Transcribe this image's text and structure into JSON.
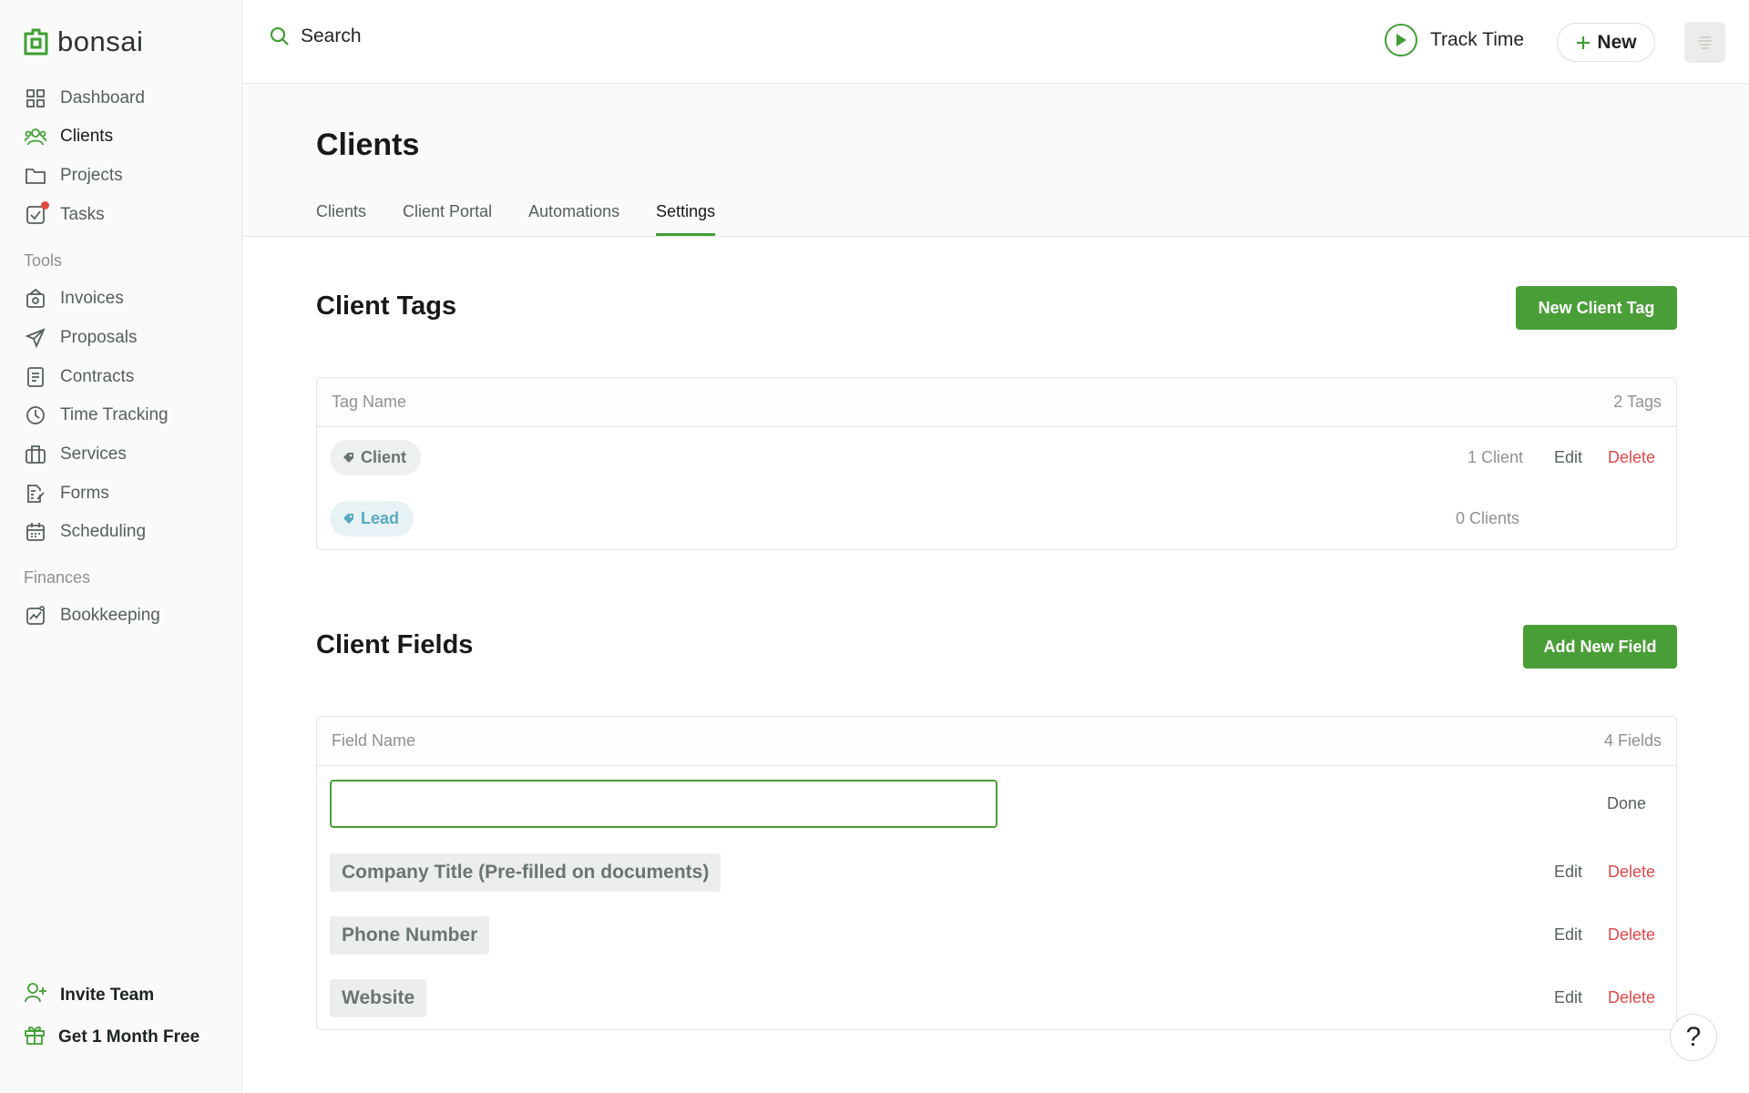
{
  "app": {
    "brand": "bonsai"
  },
  "sidebar": {
    "main_items": [
      {
        "label": "Dashboard",
        "icon": "grid-icon"
      },
      {
        "label": "Clients",
        "icon": "users-icon",
        "active": true
      },
      {
        "label": "Projects",
        "icon": "folder-icon"
      },
      {
        "label": "Tasks",
        "icon": "task-icon",
        "notification": true
      }
    ],
    "tools_heading": "Tools",
    "tools_items": [
      {
        "label": "Invoices",
        "icon": "invoice-icon"
      },
      {
        "label": "Proposals",
        "icon": "send-icon"
      },
      {
        "label": "Contracts",
        "icon": "document-icon"
      },
      {
        "label": "Time Tracking",
        "icon": "clock-icon"
      },
      {
        "label": "Services",
        "icon": "briefcase-icon"
      },
      {
        "label": "Forms",
        "icon": "form-icon"
      },
      {
        "label": "Scheduling",
        "icon": "calendar-icon"
      }
    ],
    "finances_heading": "Finances",
    "finances_items": [
      {
        "label": "Bookkeeping",
        "icon": "chart-icon"
      }
    ],
    "invite_label": "Invite Team",
    "free_label": "Get 1 Month Free"
  },
  "topbar": {
    "search_label": "Search",
    "track_time_label": "Track Time",
    "new_label": "New"
  },
  "page": {
    "title": "Clients",
    "tabs": [
      "Clients",
      "Client Portal",
      "Automations",
      "Settings"
    ],
    "active_tab": "Settings"
  },
  "tags_section": {
    "title": "Client Tags",
    "button_label": "New Client Tag",
    "header_name": "Tag Name",
    "header_count": "2 Tags",
    "rows": [
      {
        "name": "Client",
        "count": "1 Client",
        "edit": "Edit",
        "delete": "Delete"
      },
      {
        "name": "Lead",
        "count": "0 Clients"
      }
    ]
  },
  "fields_section": {
    "title": "Client Fields",
    "button_label": "Add New Field",
    "header_name": "Field Name",
    "header_count": "4 Fields",
    "new_field_value": "",
    "done_label": "Done",
    "rows": [
      {
        "name": "Company Title (Pre-filled on documents)",
        "edit": "Edit",
        "delete": "Delete"
      },
      {
        "name": "Phone Number",
        "edit": "Edit",
        "delete": "Delete"
      },
      {
        "name": "Website",
        "edit": "Edit",
        "delete": "Delete"
      }
    ]
  },
  "help": {
    "label": "?"
  },
  "colors": {
    "accent": "#4a9e37",
    "danger": "#e04848",
    "lead_tag": "#58a9c0"
  }
}
